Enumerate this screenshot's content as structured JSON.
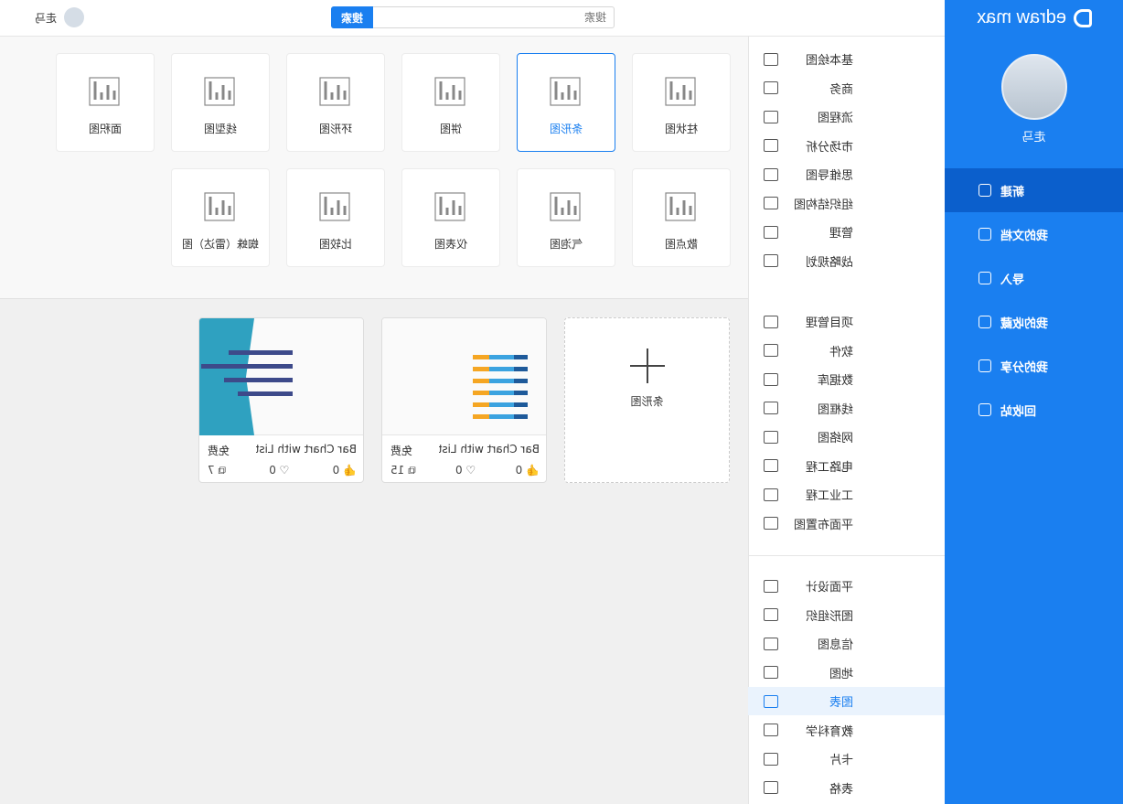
{
  "app": {
    "logo": "edraw max",
    "user": "走马"
  },
  "sidebar": {
    "items": [
      {
        "label": "新建",
        "icon": "new-file-icon",
        "active": true
      },
      {
        "label": "我的文档",
        "icon": "documents-icon"
      },
      {
        "label": "导入",
        "icon": "import-icon"
      },
      {
        "label": "我的收藏",
        "icon": "star-icon"
      },
      {
        "label": "我的分享",
        "icon": "share-icon"
      },
      {
        "label": "回收站",
        "icon": "trash-icon"
      }
    ]
  },
  "top": {
    "search_placeholder": "搜索",
    "search_button": "搜索",
    "user": "走马"
  },
  "categories": {
    "group1": [
      "基本绘图",
      "商务",
      "流程图",
      "市场分析",
      "思维导图",
      "组织结构图",
      "管理",
      "战略规划"
    ],
    "group2": [
      "项目管理",
      "软件",
      "数据库",
      "线框图",
      "网络图",
      "电路工程",
      "工业工程",
      "平面布置图"
    ],
    "group3": [
      "平面设计",
      "图形组织",
      "信息图",
      "地图",
      "图表",
      "教育科学",
      "卡片",
      "表格"
    ],
    "active": "图表"
  },
  "chart_types": [
    [
      "柱状图",
      "条形图",
      "饼图",
      "环形图",
      "线型图",
      "面积图"
    ],
    [
      "散点图",
      "气泡图",
      "仪表图",
      "比较图",
      "蜘蛛（雷达）图"
    ]
  ],
  "selected_type": "条形图",
  "templates": {
    "blank_label": "条形图",
    "items": [
      {
        "name": "Bar Chart with List-P...",
        "price": "免费",
        "likes": "0",
        "favorites": "0",
        "copies": "15"
      },
      {
        "name": "Bar Chart with List-A...",
        "price": "免费",
        "likes": "0",
        "favorites": "0",
        "copies": "7"
      }
    ]
  },
  "colors": {
    "sidebar": "#1a7ff0",
    "active": "#0b5fcc",
    "accent": "#1a7ff0"
  }
}
